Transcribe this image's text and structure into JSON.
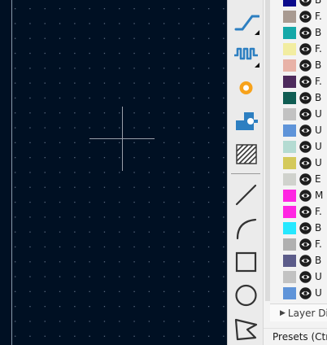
{
  "canvas": {
    "background": "#001023",
    "grid_color": "#5a6a80",
    "cursor_color": "#9aa0aa",
    "board_edge_color": "#8899aa"
  },
  "toolbar": {
    "tools": [
      {
        "name": "route-track-tool",
        "icon": "route-track-icon",
        "has_submenu": true
      },
      {
        "name": "tune-length-tool",
        "icon": "meander-icon",
        "has_submenu": true
      },
      {
        "name": "add-via-tool",
        "icon": "via-icon",
        "has_submenu": false
      },
      {
        "name": "add-footprint-tool",
        "icon": "footprint-icon",
        "has_submenu": false
      },
      {
        "name": "add-zone-tool",
        "icon": "zone-hatch-icon",
        "has_submenu": false
      },
      {
        "name": "draw-line-tool",
        "icon": "line-icon",
        "has_submenu": false
      },
      {
        "name": "draw-arc-tool",
        "icon": "arc-icon",
        "has_submenu": false
      },
      {
        "name": "draw-rectangle-tool",
        "icon": "rectangle-icon",
        "has_submenu": false
      },
      {
        "name": "draw-circle-tool",
        "icon": "circle-icon",
        "has_submenu": false
      },
      {
        "name": "draw-polygon-tool",
        "icon": "polygon-icon",
        "has_submenu": false
      }
    ]
  },
  "layers": {
    "rows": [
      {
        "color": "#0b0b8c",
        "label": "B"
      },
      {
        "color": "#a89a91",
        "label": "F."
      },
      {
        "color": "#15a8a8",
        "label": "B"
      },
      {
        "color": "#f2eda1",
        "label": "F."
      },
      {
        "color": "#e8b2a7",
        "label": "B"
      },
      {
        "color": "#4d2a5c",
        "label": "F."
      },
      {
        "color": "#0f5c52",
        "label": "B"
      },
      {
        "color": "#c2c2c2",
        "label": "U"
      },
      {
        "color": "#5f94d9",
        "label": "U"
      },
      {
        "color": "#b4dbd2",
        "label": "U"
      },
      {
        "color": "#d4c95a",
        "label": "U"
      },
      {
        "color": "#d0d2cd",
        "label": "E"
      },
      {
        "color": "#ff26e2",
        "label": "M"
      },
      {
        "color": "#ff26e2",
        "label": "F."
      },
      {
        "color": "#26e8ff",
        "label": "B"
      },
      {
        "color": "#b0b0b0",
        "label": "F."
      },
      {
        "color": "#5c5c8a",
        "label": "B"
      },
      {
        "color": "#c2c2c2",
        "label": "U"
      },
      {
        "color": "#5f94d9",
        "label": "U"
      }
    ],
    "layer_display_label": "Layer Dis",
    "presets_label": "Presets (Ctr"
  }
}
